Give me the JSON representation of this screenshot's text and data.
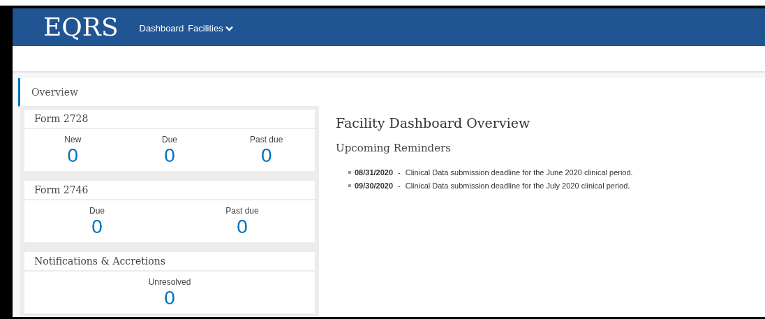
{
  "header": {
    "logo": "EQRS",
    "nav": [
      {
        "label": "Dashboard",
        "dropdown": false
      },
      {
        "label": "Facilities",
        "dropdown": true
      }
    ]
  },
  "sidebar": {
    "tab": {
      "label": "Overview",
      "selected": true
    },
    "cards": [
      {
        "title": "Form 2728",
        "stats": [
          {
            "label": "New",
            "value": "0"
          },
          {
            "label": "Due",
            "value": "0"
          },
          {
            "label": "Past due",
            "value": "0"
          }
        ]
      },
      {
        "title": "Form 2746",
        "stats": [
          {
            "label": "Due",
            "value": "0"
          },
          {
            "label": "Past due",
            "value": "0"
          }
        ]
      },
      {
        "title": "Notifications & Accretions",
        "stats": [
          {
            "label": "Unresolved",
            "value": "0"
          }
        ]
      }
    ]
  },
  "main": {
    "title": "Facility Dashboard Overview",
    "subtitle": "Upcoming Reminders",
    "reminders": [
      {
        "date": "08/31/2020",
        "separator": "-",
        "text": "Clinical Data submission deadline for the June 2020 clinical period."
      },
      {
        "date": "09/30/2020",
        "separator": "-",
        "text": "Clinical Data submission deadline for the July 2020 clinical period."
      }
    ]
  }
}
